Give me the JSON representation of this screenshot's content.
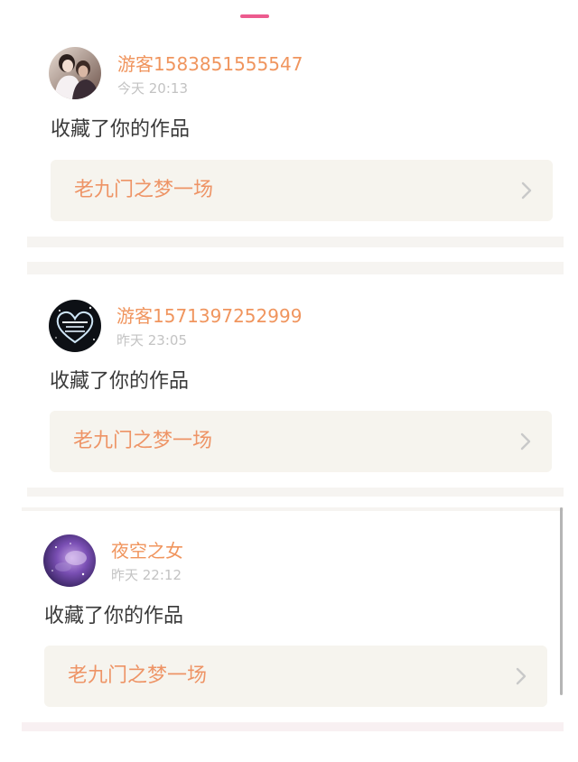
{
  "colors": {
    "accent": "#ec5b8e",
    "username": "#f0955e",
    "work_title": "#ee9466",
    "chevron": "#c9c9c9"
  },
  "notifications": [
    {
      "avatar_icon": "couple-photo-avatar",
      "username": "游客1583851555547",
      "timestamp": "今天 20:13",
      "action": "收藏了你的作品",
      "work_title": "老九门之梦一场",
      "chevron_icon": "chevron-right-icon"
    },
    {
      "avatar_icon": "heart-sparkle-avatar",
      "username": "游客1571397252999",
      "timestamp": "昨天 23:05",
      "action": "收藏了你的作品",
      "work_title": "老九门之梦一场",
      "chevron_icon": "chevron-right-icon"
    },
    {
      "avatar_icon": "galaxy-avatar",
      "username": "夜空之女",
      "timestamp": "昨天 22:12",
      "action": "收藏了你的作品",
      "work_title": "老九门之梦一场",
      "chevron_icon": "chevron-right-icon"
    }
  ]
}
